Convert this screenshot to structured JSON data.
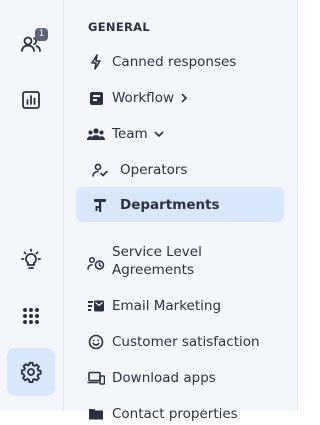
{
  "rail": {
    "contacts_badge": "1",
    "items": [
      {
        "icon": "contacts-icon"
      },
      {
        "icon": "reports-icon"
      },
      {
        "icon": "lightbulb-icon"
      },
      {
        "icon": "apps-grid-icon"
      },
      {
        "icon": "settings-icon",
        "active": true
      }
    ]
  },
  "menu": {
    "section_title": "GENERAL",
    "items": [
      {
        "label": "Canned responses",
        "icon": "lightning-icon"
      },
      {
        "label": "Workflow",
        "icon": "workflow-icon",
        "chevron": "right"
      },
      {
        "label": "Team",
        "icon": "team-icon",
        "chevron": "down"
      },
      {
        "label": "Operators",
        "icon": "operators-icon",
        "sub": true
      },
      {
        "label": "Departments",
        "icon": "departments-icon",
        "sub": true,
        "active": true
      },
      {
        "label": "Service Level Agreements",
        "icon": "sla-icon"
      },
      {
        "label": "Email Marketing",
        "icon": "email-marketing-icon"
      },
      {
        "label": "Customer satisfaction",
        "icon": "smiley-icon"
      },
      {
        "label": "Download apps",
        "icon": "devices-icon"
      },
      {
        "label": "Contact properties",
        "icon": "folder-icon"
      }
    ]
  },
  "colors": {
    "active_bg": "#d9e7fb",
    "panel_bg": "#f3f6fa",
    "text": "#2b3140"
  }
}
